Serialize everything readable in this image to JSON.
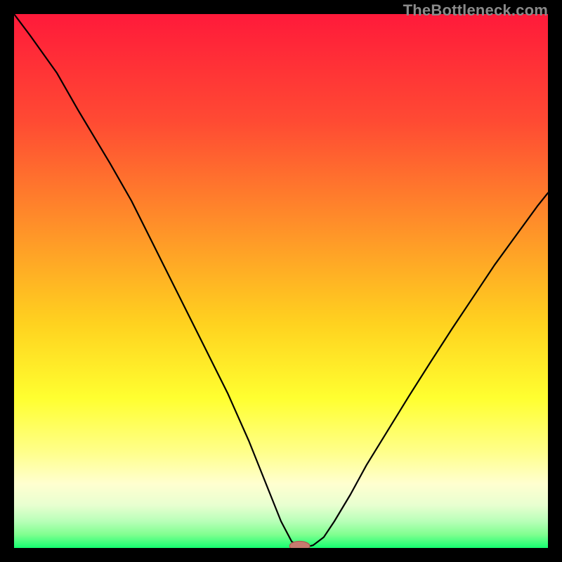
{
  "watermark": "TheBottleneck.com",
  "colors": {
    "black": "#000000",
    "curve": "#000000",
    "marker_fill": "#c77a6f",
    "marker_stroke": "#a85b50",
    "grad_top": "#ff1a3a",
    "grad_1": "#ff4a33",
    "grad_2": "#ff8a2a",
    "grad_3": "#ffd21f",
    "grad_4": "#ffff30",
    "grad_5": "#ffff8a",
    "grad_6": "#ffffd0",
    "grad_7": "#e8ffd0",
    "grad_8": "#b8ffb8",
    "grad_9": "#80ff90",
    "grad_bottom": "#15ff70"
  },
  "chart_data": {
    "type": "line",
    "title": "",
    "xlabel": "",
    "ylabel": "",
    "xlim": [
      0,
      100
    ],
    "ylim": [
      0,
      100
    ],
    "x": [
      0,
      3,
      8,
      12,
      15,
      18,
      20,
      22,
      24,
      26,
      28,
      30,
      32,
      34,
      36,
      38,
      40,
      42,
      44,
      46,
      48,
      50,
      52,
      54,
      56,
      58,
      60,
      63,
      66,
      70,
      74,
      78,
      82,
      86,
      90,
      94,
      98,
      100
    ],
    "values": [
      100,
      96,
      89,
      82,
      77,
      72,
      68.5,
      65,
      61,
      57,
      53,
      49,
      45,
      41,
      37,
      33,
      29,
      24.5,
      20,
      15,
      10,
      5,
      1.2,
      0,
      0.5,
      2,
      5,
      10,
      15.5,
      22,
      28.5,
      34.8,
      41,
      47,
      53,
      58.5,
      64,
      66.5
    ],
    "marker": {
      "x": 53.5,
      "y": 0,
      "rx": 1.9,
      "ry": 0.9
    },
    "annotations": []
  }
}
